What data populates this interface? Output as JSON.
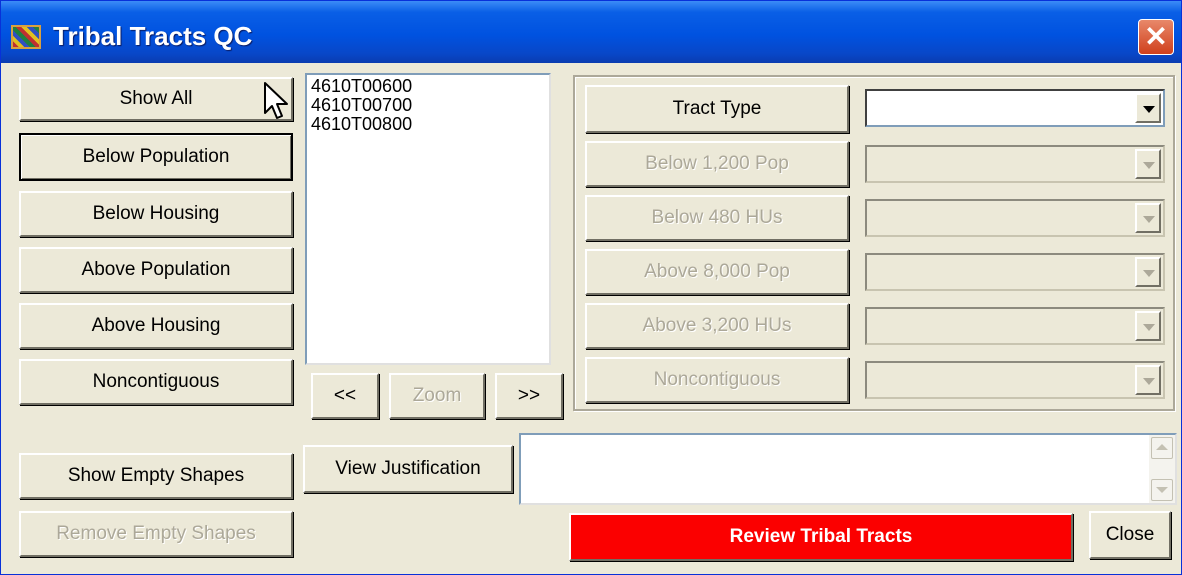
{
  "window": {
    "title": "Tribal Tracts QC",
    "close_glyph": "✕",
    "icon": "app-icon"
  },
  "left_buttons": [
    {
      "label": "Show All",
      "enabled": true
    },
    {
      "label": "Below Population",
      "enabled": true,
      "focused": true
    },
    {
      "label": "Below Housing",
      "enabled": true
    },
    {
      "label": "Above Population",
      "enabled": true
    },
    {
      "label": "Above Housing",
      "enabled": true
    },
    {
      "label": "Noncontiguous",
      "enabled": true
    }
  ],
  "tract_list": [
    "4610T00600",
    "4610T00700",
    "4610T00800"
  ],
  "nav": {
    "prev_label": "<<",
    "zoom_label": "Zoom",
    "next_label": ">>"
  },
  "criteria": [
    {
      "label": "Tract Type",
      "enabled": true,
      "value": ""
    },
    {
      "label": "Below 1,200 Pop",
      "enabled": false,
      "value": ""
    },
    {
      "label": "Below 480 HUs",
      "enabled": false,
      "value": ""
    },
    {
      "label": "Above 8,000 Pop",
      "enabled": false,
      "value": ""
    },
    {
      "label": "Above 3,200 HUs",
      "enabled": false,
      "value": ""
    },
    {
      "label": "Noncontiguous",
      "enabled": false,
      "value": ""
    }
  ],
  "bottom": {
    "show_empty_label": "Show Empty Shapes",
    "remove_empty_label": "Remove Empty Shapes",
    "view_justification_label": "View Justification",
    "justification_text": "",
    "review_label": "Review Tribal Tracts",
    "close_label": "Close"
  },
  "colors": {
    "title_bar": "#0052e0",
    "review_button": "#fb0000",
    "dialog_bg": "#ece9d8"
  }
}
